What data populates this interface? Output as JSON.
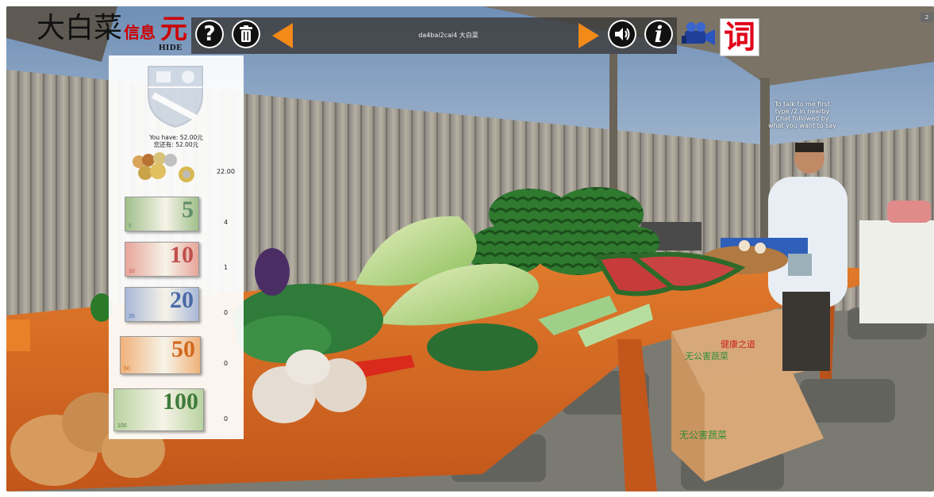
{
  "brand": {
    "title_big": "大白菜",
    "title_small": "信息",
    "currency": "元",
    "hide_label": "HIDE"
  },
  "toolbar": {
    "track_label": "da4bai2cai4 大白菜",
    "dictionary_label": "词",
    "corner_label": "2"
  },
  "wallet": {
    "you_have": "You have: 52.00元",
    "you_have_cn": "您还有: 52.00元",
    "coins_amount": "22.00",
    "notes": [
      {
        "denomination": "5",
        "count": "4",
        "color": "#9fbf8a",
        "accent": "#5f8e6a"
      },
      {
        "denomination": "10",
        "count": "1",
        "color": "#e8a59a",
        "accent": "#c0504d"
      },
      {
        "denomination": "20",
        "count": "0",
        "color": "#a8b8d8",
        "accent": "#4a6aa6"
      },
      {
        "denomination": "50",
        "count": "0",
        "color": "#f0b27a",
        "accent": "#d2691e"
      },
      {
        "denomination": "100",
        "count": "0",
        "color": "#b9d3a0",
        "accent": "#3f7a3a"
      }
    ]
  },
  "scene": {
    "npc_hint": "To talk to me first type /2 in nearby Chat followed by what you want to say",
    "box_label_1": "无公害蔬菜",
    "box_label_2": "健康之道"
  },
  "colors": {
    "accent_orange": "#f28a1a",
    "dict_red": "#e0001a",
    "table_orange": "#d9661e"
  }
}
